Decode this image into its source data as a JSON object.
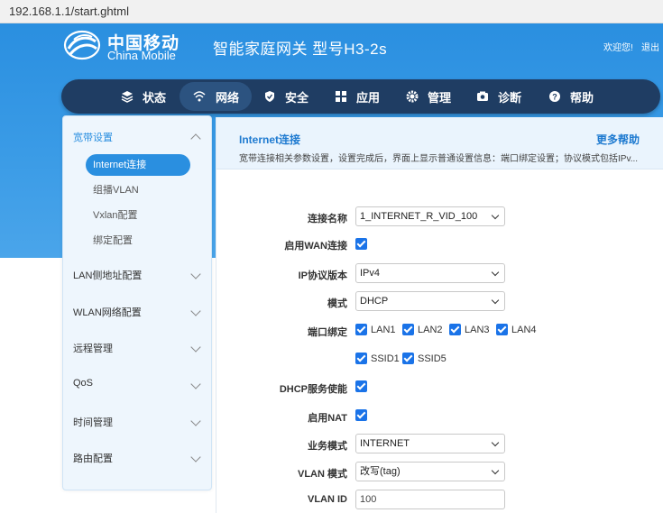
{
  "browser": {
    "url": "192.168.1.1/start.ghtml"
  },
  "header": {
    "brand_cn": "中国移动",
    "brand_en": "China Mobile",
    "gateway_title": "智能家庭网关 型号H3-2s",
    "welcome": "欢迎您!",
    "logout": "退出"
  },
  "nav": {
    "items": [
      {
        "label": "状态",
        "icon": "layers-icon"
      },
      {
        "label": "网络",
        "icon": "wifi-icon"
      },
      {
        "label": "安全",
        "icon": "shield-icon"
      },
      {
        "label": "应用",
        "icon": "grid-icon"
      },
      {
        "label": "管理",
        "icon": "gear-icon"
      },
      {
        "label": "诊断",
        "icon": "camera-icon"
      },
      {
        "label": "帮助",
        "icon": "help-icon"
      }
    ],
    "active": "网络"
  },
  "sidebar": {
    "groups": [
      {
        "label": "宽带设置",
        "expanded": true
      },
      {
        "label": "LAN侧地址配置"
      },
      {
        "label": "WLAN网络配置"
      },
      {
        "label": "远程管理"
      },
      {
        "label": "QoS"
      },
      {
        "label": "时间管理"
      },
      {
        "label": "路由配置"
      }
    ],
    "subitems": [
      {
        "label": "Internet连接",
        "active": true
      },
      {
        "label": "组播VLAN"
      },
      {
        "label": "Vxlan配置"
      },
      {
        "label": "绑定配置"
      }
    ]
  },
  "content": {
    "title": "Internet连接",
    "more_help": "更多帮助",
    "description": "宽带连接相关参数设置，设置完成后，界面上显示普通设置信息：端口绑定设置；协议模式包括IPv..."
  },
  "form": {
    "connection_name": {
      "label": "连接名称",
      "value": "1_INTERNET_R_VID_100"
    },
    "enable_wan": {
      "label": "启用WAN连接",
      "checked": true
    },
    "ip_version": {
      "label": "IP协议版本",
      "value": "IPv4"
    },
    "mode": {
      "label": "模式",
      "value": "DHCP"
    },
    "port_binding": {
      "label": "端口绑定",
      "options": [
        {
          "label": "LAN1",
          "checked": true
        },
        {
          "label": "LAN2",
          "checked": true
        },
        {
          "label": "LAN3",
          "checked": true
        },
        {
          "label": "LAN4",
          "checked": true
        },
        {
          "label": "SSID1",
          "checked": true
        },
        {
          "label": "SSID5",
          "checked": true
        }
      ]
    },
    "dhcp_server": {
      "label": "DHCP服务使能",
      "checked": true
    },
    "enable_nat": {
      "label": "启用NAT",
      "checked": true
    },
    "service_mode": {
      "label": "业务模式",
      "value": "INTERNET"
    },
    "vlan_mode": {
      "label": "VLAN 模式",
      "value": "改写(tag)"
    },
    "vlan_id": {
      "label": "VLAN ID",
      "value": "100"
    }
  },
  "colors": {
    "hero_blue": "#2a8fe0",
    "nav_dark": "#1f3d63",
    "accent": "#1e7ad0",
    "checkbox": "#1a73e8"
  }
}
